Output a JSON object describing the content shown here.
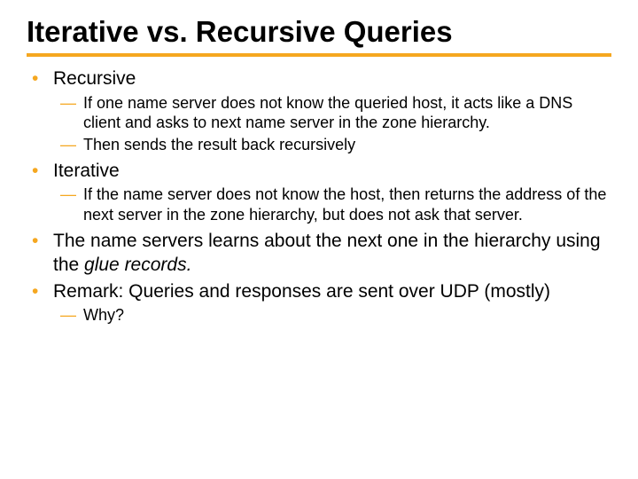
{
  "title": "Iterative vs. Recursive Queries",
  "bullets": [
    {
      "text": "Recursive",
      "sub": [
        "If one name server does not know the queried host, it acts like a DNS client and asks to next name server in the zone hierarchy.",
        "Then sends the result back recursively"
      ]
    },
    {
      "text": "Iterative",
      "sub": [
        "If the name server does not know the host, then returns the address of the next server in the zone hierarchy, but does not ask that server."
      ]
    },
    {
      "pre": "The name servers learns about the next one in the hierarchy using the ",
      "em": "glue records.",
      "sub": []
    },
    {
      "text": "Remark: Queries and responses are sent over UDP (mostly)",
      "sub": [
        "Why?"
      ]
    }
  ]
}
